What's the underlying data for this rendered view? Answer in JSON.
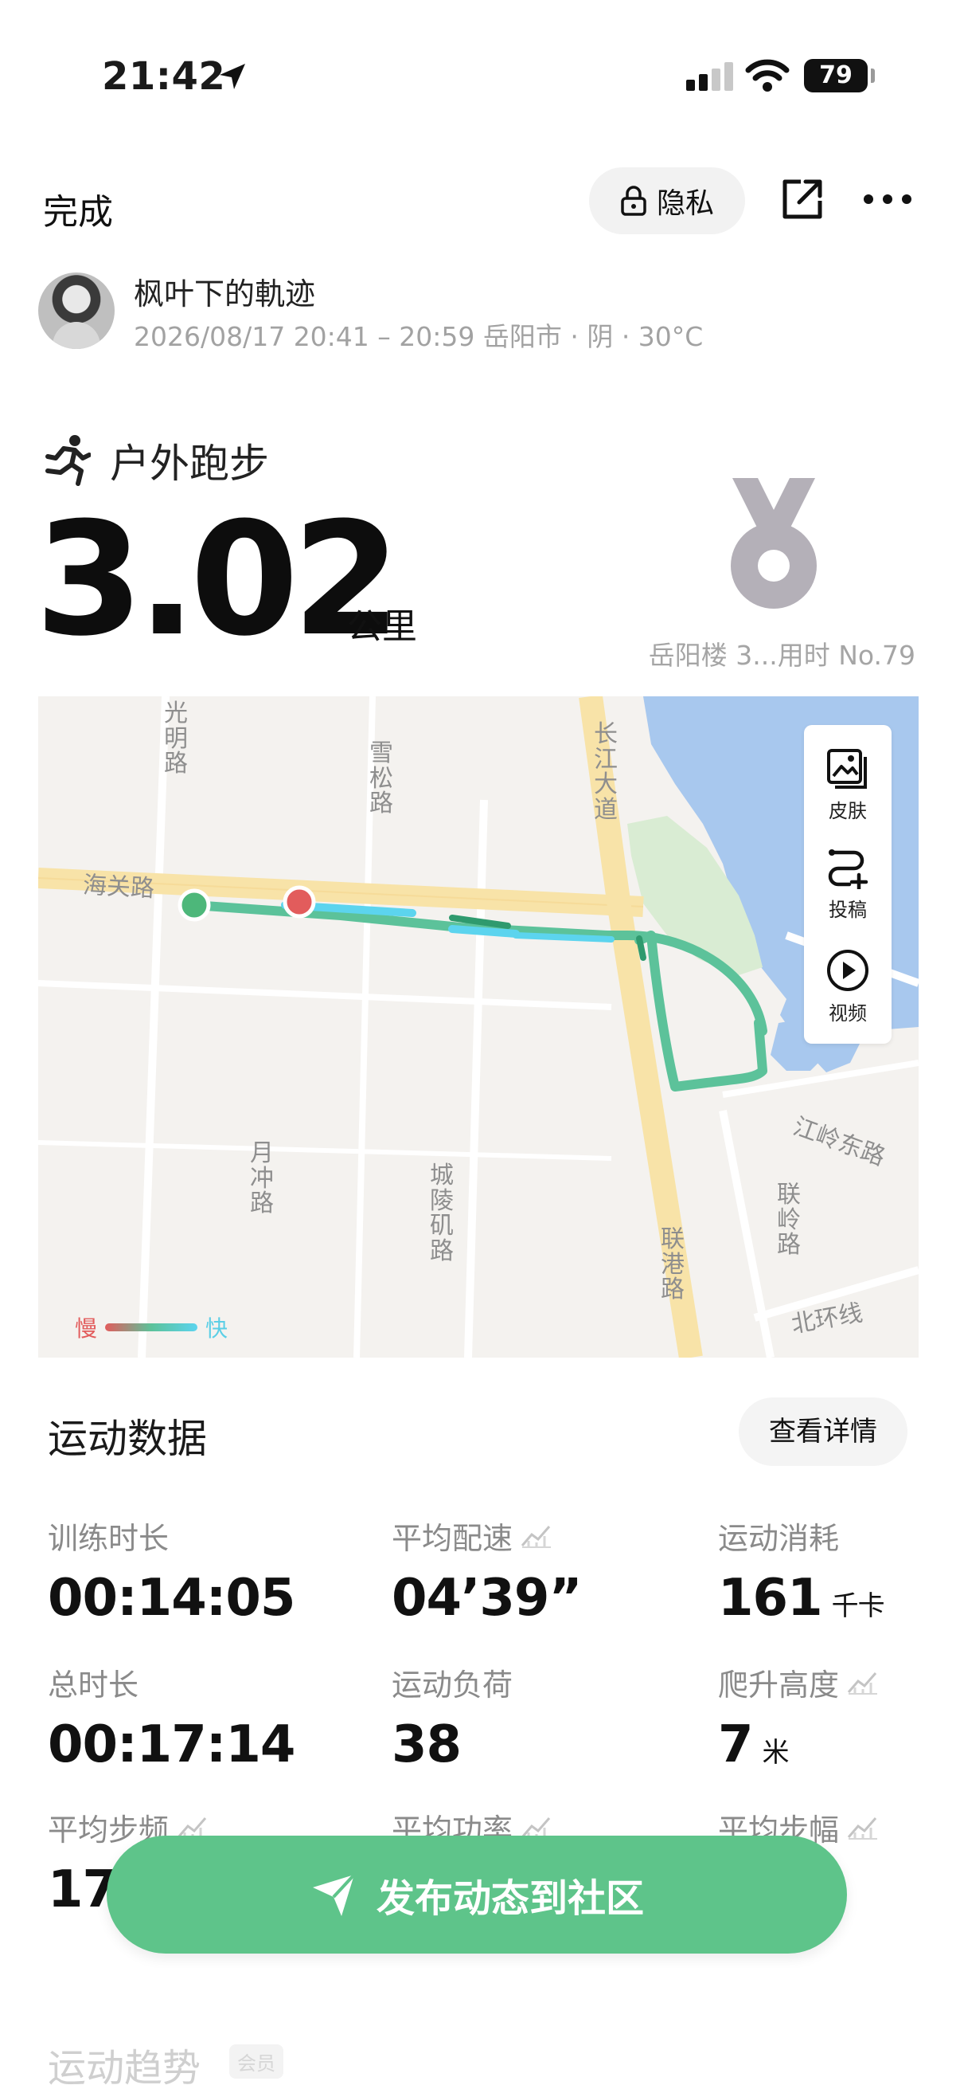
{
  "status_bar": {
    "time": "21:42",
    "battery": "79"
  },
  "header": {
    "done_label": "完成",
    "privacy_label": "隐私"
  },
  "user": {
    "name": "枫叶下的軌迹",
    "meta": "2026/08/17 20:41 – 20:59 岳阳市 · 阴 · 30°C"
  },
  "activity": {
    "type": "户外跑步",
    "distance": "3.02",
    "distance_unit": "公里",
    "medal_caption": "岳阳楼 3...用时 No.79"
  },
  "map": {
    "labels": {
      "guangming": "光明路",
      "xuesong": "雪松路",
      "changjiang": "长江大道",
      "haiguan": "海关路",
      "yuechong": "月冲路",
      "chengling": "城陵矶路",
      "liangang": "联港路",
      "jiangling": "江岭东路",
      "lianling": "联岭路",
      "beihuan": "北环线"
    },
    "tools": {
      "skin": "皮肤",
      "contribute": "投稿",
      "video": "视频"
    },
    "legend": {
      "slow": "慢",
      "fast": "快"
    }
  },
  "stats": {
    "title": "运动数据",
    "detail_label": "查看详情",
    "items": [
      {
        "label": "训练时长",
        "value": "00:14:05",
        "unit": ""
      },
      {
        "label": "平均配速",
        "value": "04’39”",
        "unit": ""
      },
      {
        "label": "运动消耗",
        "value": "161",
        "unit": "千卡"
      },
      {
        "label": "总时长",
        "value": "00:17:14",
        "unit": ""
      },
      {
        "label": "运动负荷",
        "value": "38",
        "unit": ""
      },
      {
        "label": "爬升高度",
        "value": "7",
        "unit": "米"
      },
      {
        "label": "平均步频",
        "value": "178",
        "unit": ""
      },
      {
        "label": "平均功率",
        "value": "",
        "unit": ""
      },
      {
        "label": "平均步幅",
        "value": "",
        "unit": "米"
      }
    ]
  },
  "post_button": {
    "label": "发布动态到社区"
  },
  "trend": {
    "title": "运动趋势",
    "badge": "会员"
  },
  "colors": {
    "accent_green": "#5ec48a",
    "route_green": "#5cc29a",
    "start_green": "#4db77a",
    "end_red": "#e25c5c",
    "water_blue": "#a8c8ee",
    "road_yellow": "#f8e3a8"
  },
  "icons": [
    "location-arrow-icon",
    "cellular-signal-icon",
    "wifi-icon",
    "battery-icon",
    "lock-icon",
    "share-icon",
    "more-icon",
    "running-icon",
    "medal-icon",
    "skin-icon",
    "contribute-icon",
    "video-icon",
    "chart-trend-icon",
    "paper-plane-icon"
  ]
}
